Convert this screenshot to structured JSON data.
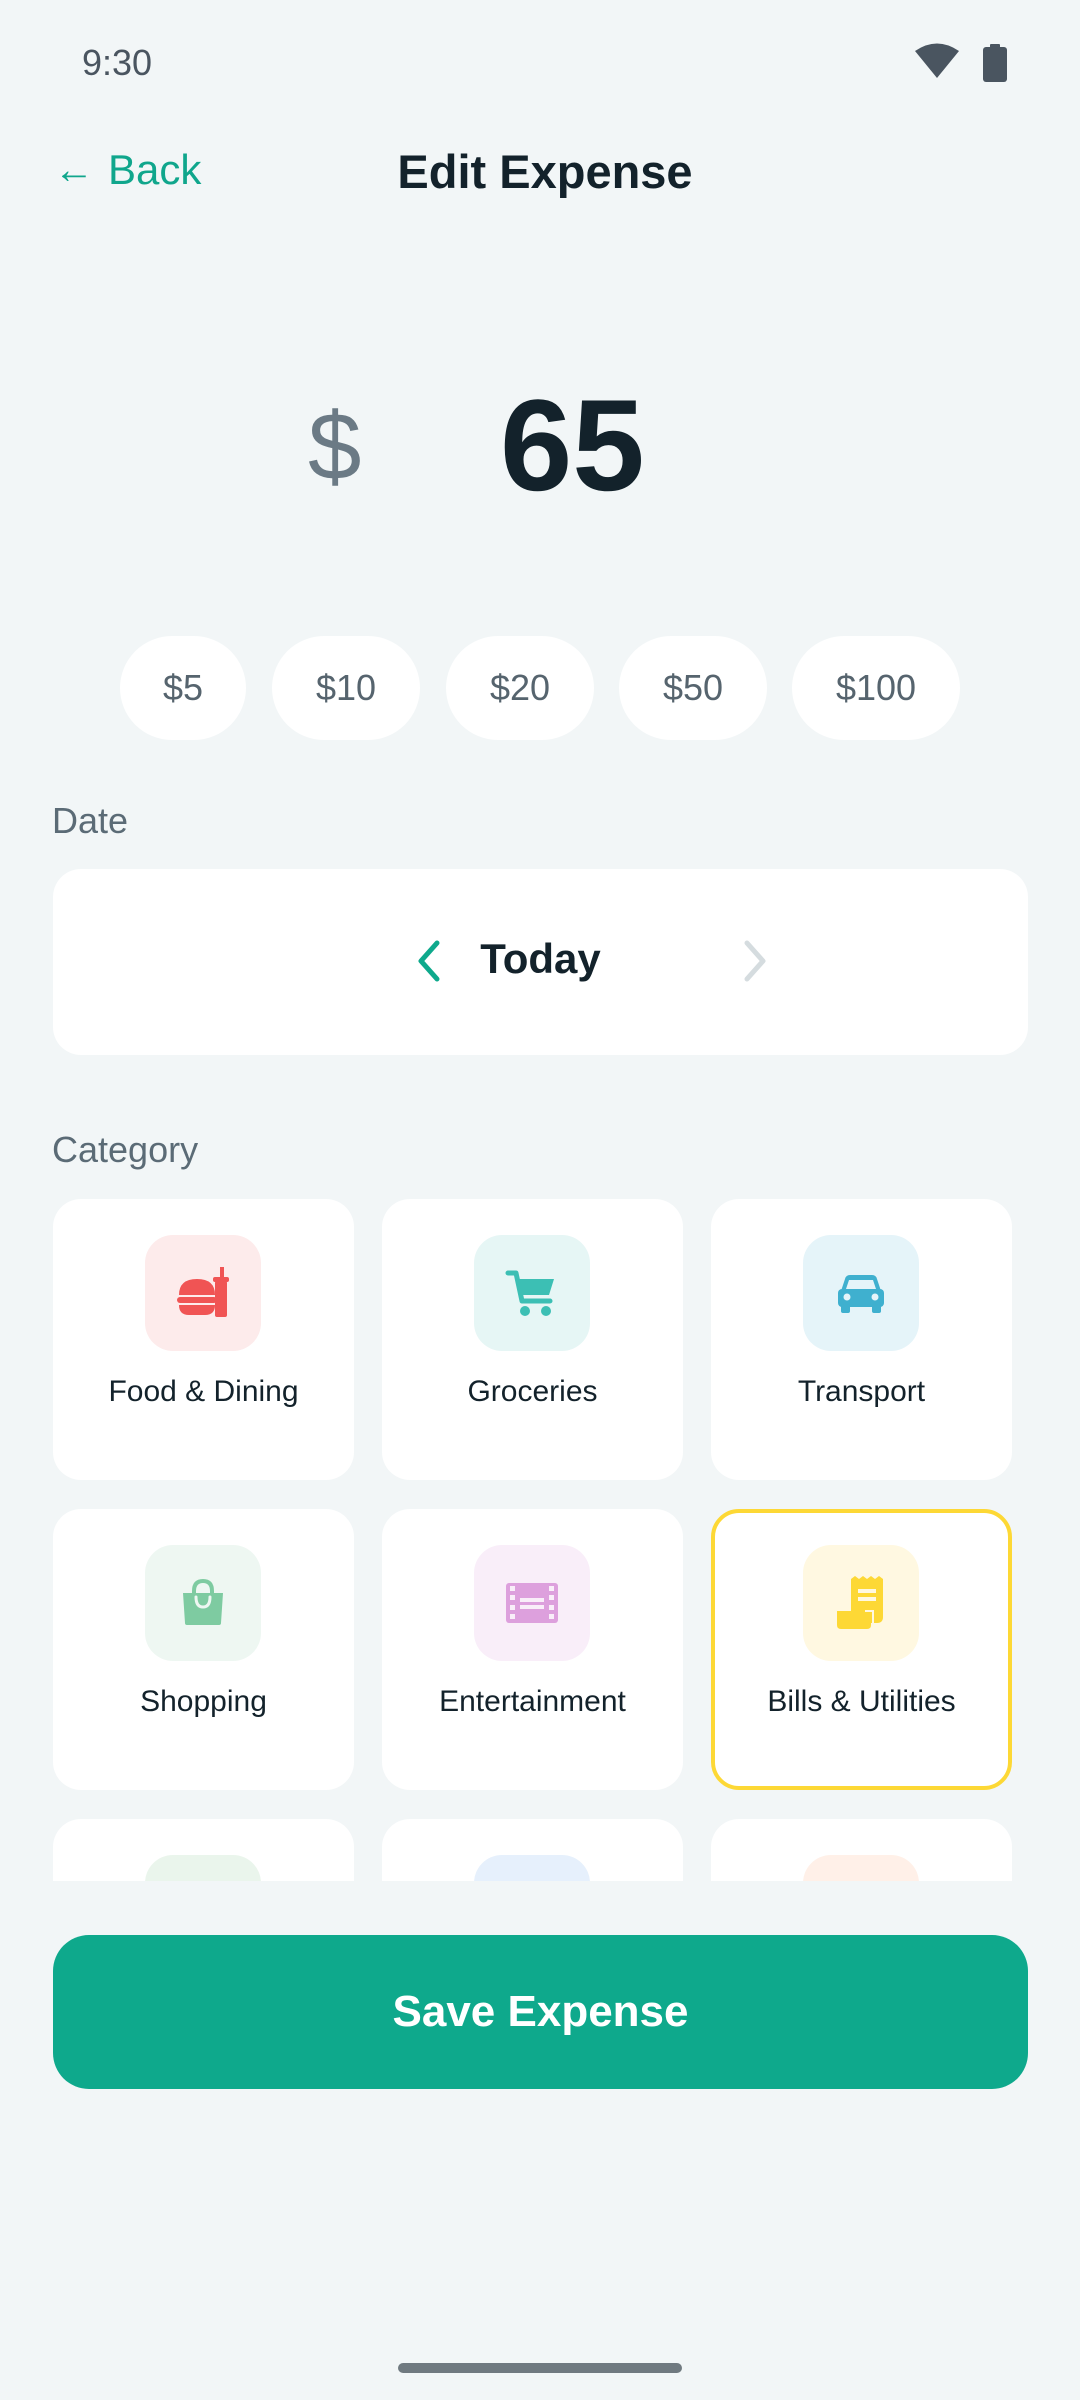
{
  "status_bar": {
    "time": "9:30"
  },
  "header": {
    "back_label": "Back",
    "title": "Edit Expense"
  },
  "amount": {
    "currency": "$",
    "value": "65"
  },
  "quick_amounts": [
    "$5",
    "$10",
    "$20",
    "$50",
    "$100"
  ],
  "date": {
    "label": "Date",
    "value": "Today"
  },
  "category": {
    "label": "Category",
    "items": [
      {
        "label": "Food & Dining",
        "icon": "food-icon",
        "tile_color": "#FDEBEB",
        "icon_color": "#F05454"
      },
      {
        "label": "Groceries",
        "icon": "cart-icon",
        "tile_color": "#E6F6F5",
        "icon_color": "#3CBFB4"
      },
      {
        "label": "Transport",
        "icon": "car-icon",
        "tile_color": "#E5F4F9",
        "icon_color": "#3FB0CF"
      },
      {
        "label": "Shopping",
        "icon": "shopping-bag-icon",
        "tile_color": "#EEF7F2",
        "icon_color": "#7ECBA1"
      },
      {
        "label": "Entertainment",
        "icon": "film-icon",
        "tile_color": "#F9EEF9",
        "icon_color": "#DDA0DD"
      },
      {
        "label": "Bills & Utilities",
        "icon": "receipt-icon",
        "tile_color": "#FFF8E1",
        "icon_color": "#FDD835",
        "selected": true
      }
    ]
  },
  "save_button": {
    "label": "Save Expense"
  },
  "colors": {
    "accent": "#0EA98C",
    "background": "#F2F6F7",
    "selected_border": "#FDD835"
  }
}
